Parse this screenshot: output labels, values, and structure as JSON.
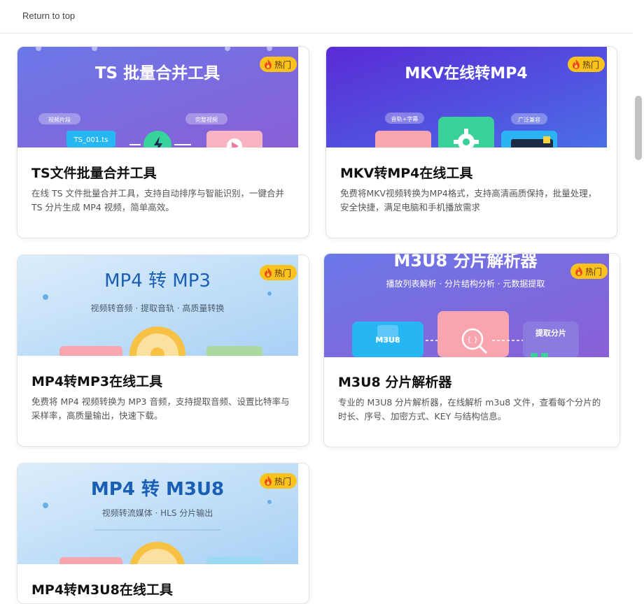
{
  "topbar": {
    "return_label": "Return to top"
  },
  "badge_label": "热门",
  "cards": [
    {
      "banner": {
        "title": "TS 批量合并工具",
        "chip_left": "视频片段",
        "chip_right": "完整视频",
        "file_label": "TS_001.ts"
      },
      "title": "TS文件批量合并工具",
      "desc": "在线 TS 文件批量合并工具，支持自动排序与智能识别，一键合并 TS 分片生成 MP4 视频，简单高效。"
    },
    {
      "banner": {
        "title": "MKV在线转MP4",
        "chip_left": "音轨+字幕",
        "chip_right": "广泛兼容"
      },
      "title": "MKV转MP4在线工具",
      "desc": "免费将MKV视频转换为MP4格式，支持高清画质保持，批量处理，安全快捷，满足电脑和手机播放需求"
    },
    {
      "banner": {
        "title": "MP4 转 MP3",
        "subtitle": "视频转音频 · 提取音轨 · 高质量转换"
      },
      "title": "MP4转MP3在线工具",
      "desc": "免费将 MP4 视频转换为 MP3 音频，支持提取音频、设置比特率与采样率，高质量输出，快速下载。"
    },
    {
      "banner": {
        "title": "M3U8 分片解析器",
        "subtitle": "播放列表解析 · 分片结构分析 · 元数据提取",
        "file_label": "M3U8",
        "center_glyph": "{ }",
        "right_label": "提取分片"
      },
      "title": "M3U8 分片解析器",
      "desc": "专业的 M3U8 分片解析器，在线解析 m3u8 文件，查看每个分片的时长、序号、加密方式、KEY 与结构信息。"
    },
    {
      "banner": {
        "title": "MP4 转 M3U8",
        "subtitle": "视频转流媒体 · HLS 分片输出"
      },
      "title": "MP4转M3U8在线工具",
      "desc": ""
    }
  ],
  "colors": {
    "purple_start": "#6d6de6",
    "purple_end": "#8a5fd6",
    "light_blue_start": "#d6ebfb",
    "light_blue_end": "#a9d3f6",
    "badge": "#f9c31c",
    "title_blue": "#1a5fb4"
  },
  "icons": [
    "flame-icon",
    "play-icon",
    "lightning-icon",
    "gear-icon",
    "search-braces-icon",
    "vinyl-icon"
  ]
}
